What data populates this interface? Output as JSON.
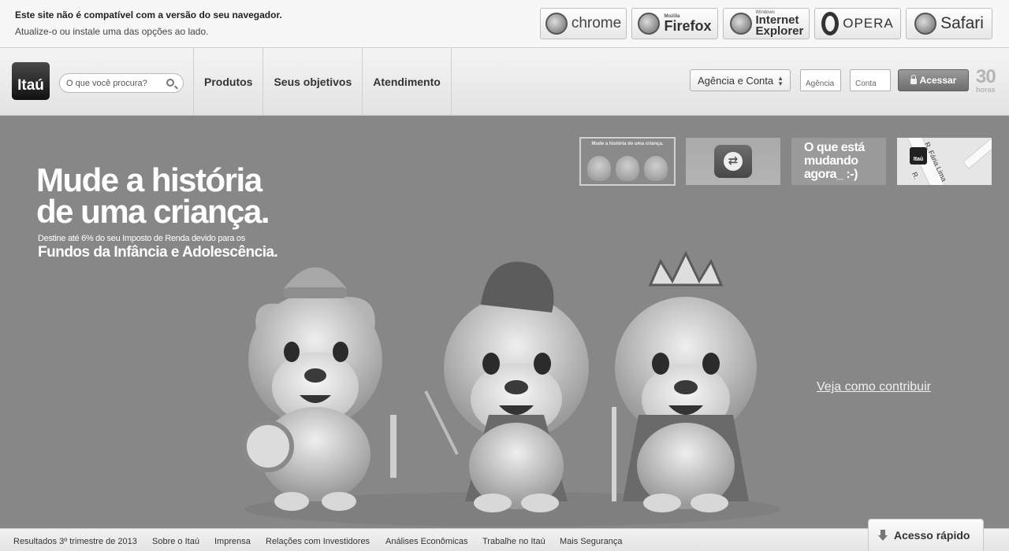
{
  "warning": {
    "title": "Este site não é compatível com a versão do seu navegador.",
    "subtitle": "Atualize-o ou instale uma das opções ao lado."
  },
  "browsers": [
    {
      "name": "chrome",
      "icon": "chrome-icon"
    },
    {
      "name": "Firefox",
      "label_top": "Mozilla",
      "icon": "firefox-icon"
    },
    {
      "name": "Internet Explorer",
      "label_top": "Windows",
      "icon": "ie-icon"
    },
    {
      "name": "OPERA",
      "icon": "opera-icon"
    },
    {
      "name": "Safari",
      "icon": "safari-icon"
    }
  ],
  "header": {
    "logo": "Itaú",
    "search_placeholder": "O que você procura?",
    "nav": [
      "Produtos",
      "Seus objetivos",
      "Atendimento"
    ],
    "account_type": "Agência e Conta",
    "agency_placeholder": "Agência",
    "account_placeholder": "Conta",
    "access_label": "Acessar",
    "hours_number": "30",
    "hours_label": "horas"
  },
  "banner": {
    "headline_1": "Mude a história",
    "headline_2": "de uma criança.",
    "subline": "Destine até 6% do seu Imposto de Renda devido para os",
    "subline_strong": "Fundos da Infância e Adolescência.",
    "cta": "Veja como contribuir",
    "thumbs": {
      "t1_caption": "Mude a história de uma criança.",
      "t3_line1": "O que está",
      "t3_line2": "mudando",
      "t3_line3": "agora_ :-)",
      "t4_logo": "Itaú",
      "t4_street": "R. Fária Lima",
      "t4_street2": "R."
    }
  },
  "footer": {
    "links": [
      "Resultados 3º trimestre de 2013",
      "Sobre o Itaú",
      "Imprensa",
      "Relações com Investidores",
      "Análises Econômicas",
      "Trabalhe no Itaú",
      "Mais Segurança"
    ],
    "quick_access": "Acesso rápido"
  }
}
